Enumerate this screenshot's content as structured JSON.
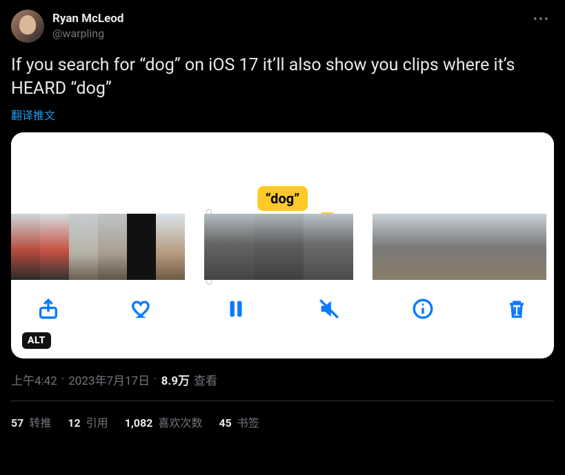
{
  "author": {
    "display_name": "Ryan McLeod",
    "handle": "@warpling"
  },
  "tweet_text": "If you search for “dog” on iOS 17 it’ll also show you clips where it’s HEARD “dog”",
  "translate_label": "翻译推文",
  "media": {
    "caption_tag": "“dog”",
    "alt_badge": "ALT"
  },
  "meta": {
    "time": "上午4:42",
    "date": "2023年7月17日",
    "sep": " · ",
    "views_count": "8.9万",
    "views_label": " 查看"
  },
  "stats": {
    "retweets_count": "57",
    "retweets_label": " 转推",
    "quotes_count": "12",
    "quotes_label": " 引用",
    "likes_count": "1,082",
    "likes_label": " 喜欢次数",
    "bookmarks_count": "45",
    "bookmarks_label": " 书签"
  }
}
